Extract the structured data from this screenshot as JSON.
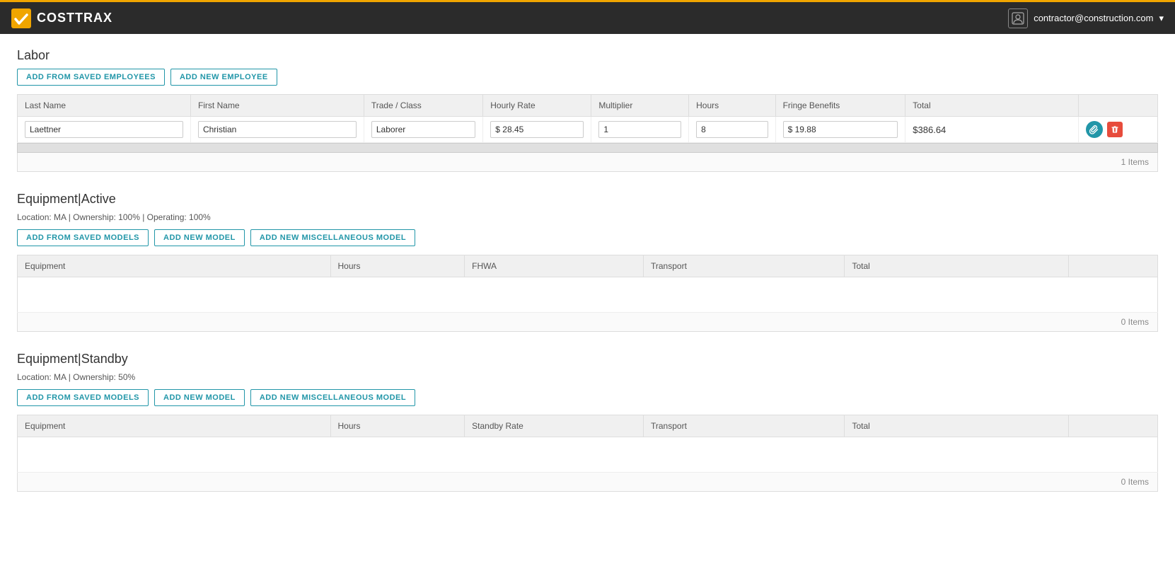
{
  "header": {
    "logo_text": "COSTTRAX",
    "user_email": "contractor@construction.com",
    "user_dropdown_icon": "▾"
  },
  "labor": {
    "section_title": "Labor",
    "btn_add_saved": "ADD FROM SAVED EMPLOYEES",
    "btn_add_new": "ADD NEW EMPLOYEE",
    "columns": [
      "Last Name",
      "First Name",
      "Trade / Class",
      "Hourly Rate",
      "Multiplier",
      "Hours",
      "Fringe Benefits",
      "Total"
    ],
    "rows": [
      {
        "last_name": "Laettner",
        "first_name": "Christian",
        "trade": "Laborer",
        "hourly_rate": "$ 28.45",
        "multiplier": "1",
        "hours": "8",
        "fringe_benefits": "$ 19.88",
        "total": "$386.64"
      }
    ],
    "item_count": "1 Items"
  },
  "equipment_active": {
    "section_title": "Equipment|Active",
    "section_subtitle": "Location: MA | Ownership: 100% | Operating: 100%",
    "btn_add_saved": "ADD FROM SAVED MODELS",
    "btn_add_new": "ADD NEW MODEL",
    "btn_add_misc": "ADD NEW MISCELLANEOUS MODEL",
    "columns": [
      "Equipment",
      "Hours",
      "FHWA",
      "Transport",
      "Total"
    ],
    "rows": [],
    "item_count": "0 Items"
  },
  "equipment_standby": {
    "section_title": "Equipment|Standby",
    "section_subtitle": "Location: MA | Ownership: 50%",
    "btn_add_saved": "ADD FROM SAVED MODELS",
    "btn_add_new": "ADD NEW MODEL",
    "btn_add_misc": "ADD NEW MISCELLANEOUS MODEL",
    "columns": [
      "Equipment",
      "Hours",
      "Standby Rate",
      "Transport",
      "Total"
    ],
    "rows": [],
    "item_count": "0 Items"
  }
}
